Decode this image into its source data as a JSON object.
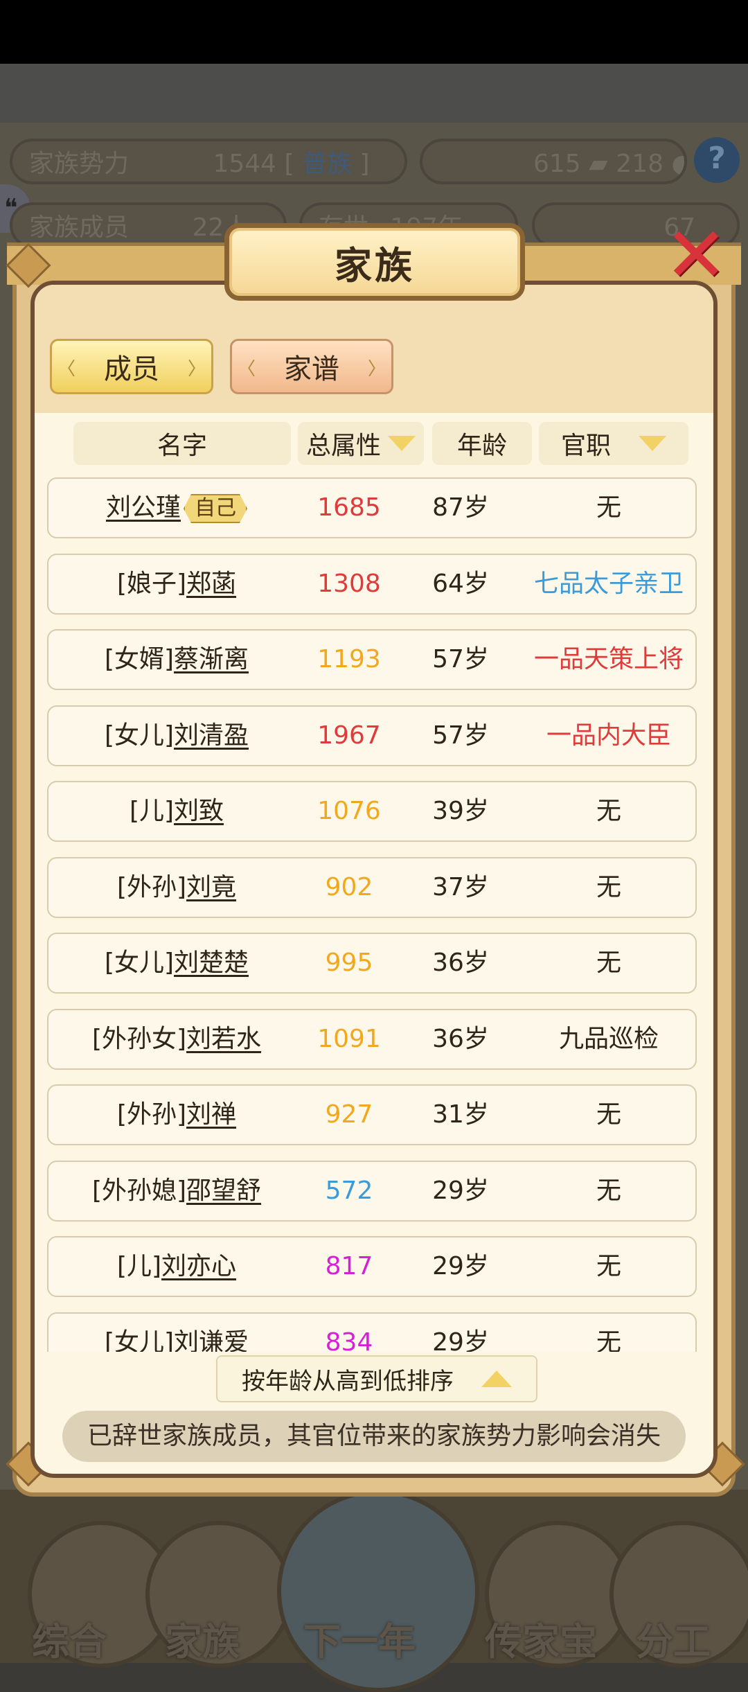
{
  "background": {
    "stat_power_label": "家族势力",
    "stat_power_value": "1544",
    "stat_power_bracket_open": "[",
    "stat_power_rank": "普族",
    "stat_power_bracket_close": "]",
    "currency_a": "615",
    "currency_b": "218",
    "members_label": "家族成员",
    "members_value": "22人",
    "lineage_label": "存世",
    "lineage_value": "197年",
    "gold_value": "67",
    "help_glyph": "?",
    "nav": [
      "综合",
      "家族",
      "下一年",
      "传家宝",
      "分工"
    ]
  },
  "dialog": {
    "title": "家族",
    "close_glyph": "✕",
    "tabs": [
      {
        "label": "成员",
        "active": true
      },
      {
        "label": "家谱",
        "active": false
      }
    ],
    "columns": {
      "name": "名字",
      "attr": "总属性",
      "age": "年龄",
      "position": "官职"
    },
    "self_badge": "自己",
    "members": [
      {
        "prefix": "",
        "name": "刘公瑾",
        "self": true,
        "attr": "1685",
        "attr_color": "#e03a3a",
        "age": "87岁",
        "position": "无",
        "position_color": "#2e2418"
      },
      {
        "prefix": "[娘子]",
        "name": "郑菡",
        "self": false,
        "attr": "1308",
        "attr_color": "#e03a3a",
        "age": "64岁",
        "position": "七品太子亲卫",
        "position_color": "#3b9ad9"
      },
      {
        "prefix": "[女婿]",
        "name": "蔡渐离",
        "self": false,
        "attr": "1193",
        "attr_color": "#f2a81d",
        "age": "57岁",
        "position": "一品天策上将",
        "position_color": "#e03a3a"
      },
      {
        "prefix": "[女儿]",
        "name": "刘清盈",
        "self": false,
        "attr": "1967",
        "attr_color": "#e03a3a",
        "age": "57岁",
        "position": "一品内大臣",
        "position_color": "#e03a3a"
      },
      {
        "prefix": "[儿]",
        "name": "刘致",
        "self": false,
        "attr": "1076",
        "attr_color": "#f2a81d",
        "age": "39岁",
        "position": "无",
        "position_color": "#2e2418"
      },
      {
        "prefix": "[外孙]",
        "name": "刘竟",
        "self": false,
        "attr": "902",
        "attr_color": "#f2a81d",
        "age": "37岁",
        "position": "无",
        "position_color": "#2e2418"
      },
      {
        "prefix": "[女儿]",
        "name": "刘楚楚",
        "self": false,
        "attr": "995",
        "attr_color": "#f2a81d",
        "age": "36岁",
        "position": "无",
        "position_color": "#2e2418"
      },
      {
        "prefix": "[外孙女]",
        "name": "刘若水",
        "self": false,
        "attr": "1091",
        "attr_color": "#f2a81d",
        "age": "36岁",
        "position": "九品巡检",
        "position_color": "#2e2418"
      },
      {
        "prefix": "[外孙]",
        "name": "刘禅",
        "self": false,
        "attr": "927",
        "attr_color": "#f2a81d",
        "age": "31岁",
        "position": "无",
        "position_color": "#2e2418"
      },
      {
        "prefix": "[外孙媳]",
        "name": "邵望舒",
        "self": false,
        "attr": "572",
        "attr_color": "#3b9ad9",
        "age": "29岁",
        "position": "无",
        "position_color": "#2e2418"
      },
      {
        "prefix": "[儿]",
        "name": "刘亦心",
        "self": false,
        "attr": "817",
        "attr_color": "#d81fd8",
        "age": "29岁",
        "position": "无",
        "position_color": "#2e2418"
      },
      {
        "prefix": "[女儿]",
        "name": "刘谦爱",
        "self": false,
        "attr": "834",
        "attr_color": "#d81fd8",
        "age": "29岁",
        "position": "无",
        "position_color": "#2e2418"
      }
    ],
    "sort_label": "按年龄从高到低排序",
    "notice": "已辞世家族成员，其官位带来的家族势力影响会消失"
  }
}
